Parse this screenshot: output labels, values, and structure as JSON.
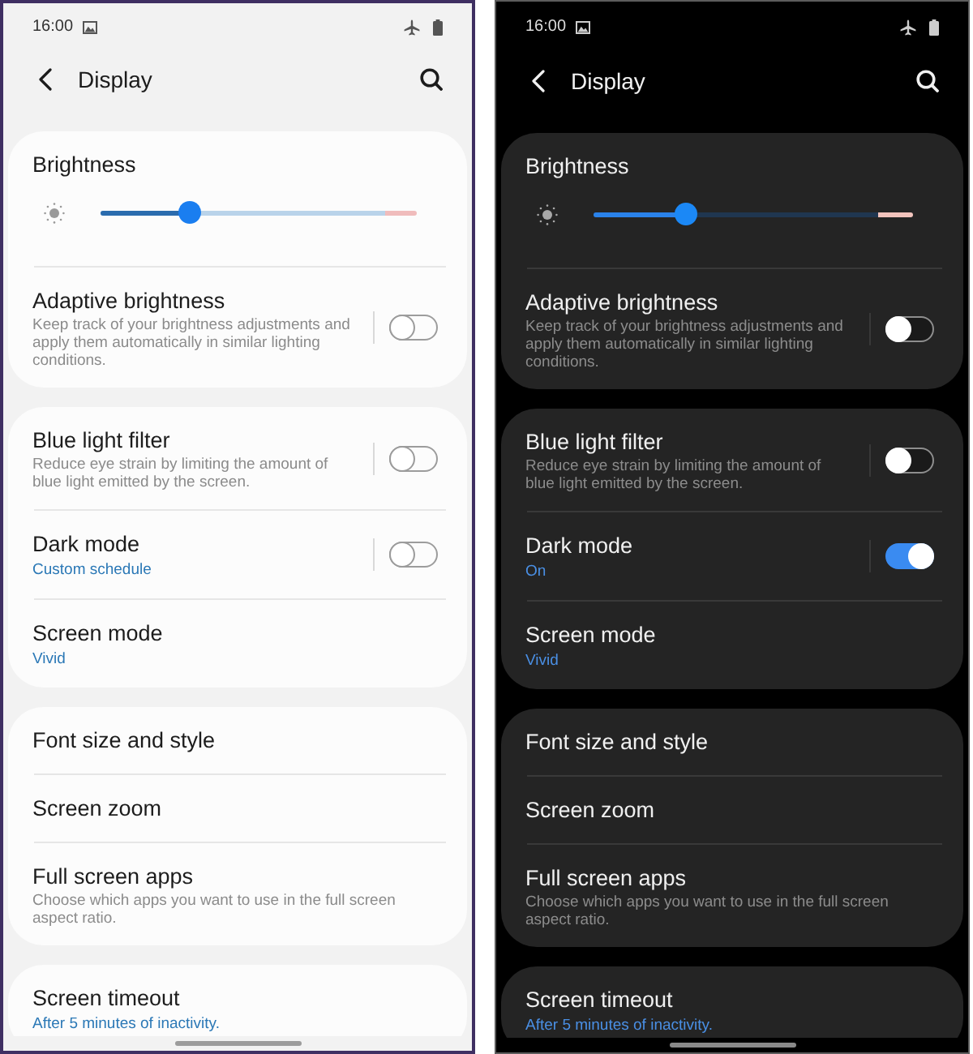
{
  "screens": [
    {
      "dark": false,
      "status_bar": {
        "time": "16:00"
      },
      "header": {
        "title": "Display"
      },
      "cards": [
        {
          "items": [
            {
              "kind": "slider",
              "title": "Brightness",
              "level": 0.28
            },
            {
              "kind": "switch",
              "title": "Adaptive brightness",
              "description": "Keep track of your brightness adjustments and apply them automatically in similar lighting conditions.",
              "on": false
            }
          ]
        },
        {
          "items": [
            {
              "kind": "switch",
              "title": "Blue light filter",
              "description": "Reduce eye strain by limiting the amount of blue light emitted by the screen.",
              "on": false
            },
            {
              "kind": "switch",
              "title": "Dark mode",
              "value": "Custom schedule",
              "on": false
            },
            {
              "kind": "item",
              "title": "Screen mode",
              "value": "Vivid"
            }
          ]
        },
        {
          "items": [
            {
              "kind": "item",
              "title": "Font size and style"
            },
            {
              "kind": "item",
              "title": "Screen zoom"
            },
            {
              "kind": "item",
              "title": "Full screen apps",
              "description": "Choose which apps you want to use in the full screen aspect ratio."
            }
          ]
        },
        {
          "items": [
            {
              "kind": "item",
              "title": "Screen timeout",
              "value": "After 5 minutes of inactivity."
            }
          ]
        }
      ]
    },
    {
      "dark": true,
      "status_bar": {
        "time": "16:00"
      },
      "header": {
        "title": "Display"
      },
      "cards": [
        {
          "items": [
            {
              "kind": "slider",
              "title": "Brightness",
              "level": 0.29
            },
            {
              "kind": "switch",
              "title": "Adaptive brightness",
              "description": "Keep track of your brightness adjustments and apply them automatically in similar lighting conditions.",
              "on": false
            }
          ]
        },
        {
          "items": [
            {
              "kind": "switch",
              "title": "Blue light filter",
              "description": "Reduce eye strain by limiting the amount of blue light emitted by the screen.",
              "on": false
            },
            {
              "kind": "switch",
              "title": "Dark mode",
              "value": "On",
              "on": true
            },
            {
              "kind": "item",
              "title": "Screen mode",
              "value": "Vivid"
            }
          ]
        },
        {
          "items": [
            {
              "kind": "item",
              "title": "Font size and style"
            },
            {
              "kind": "item",
              "title": "Screen zoom"
            },
            {
              "kind": "item",
              "title": "Full screen apps",
              "description": "Choose which apps you want to use in the full screen aspect ratio."
            }
          ]
        },
        {
          "items": [
            {
              "kind": "item",
              "title": "Screen timeout",
              "value": "After 5 minutes of inactivity."
            }
          ]
        }
      ]
    }
  ]
}
